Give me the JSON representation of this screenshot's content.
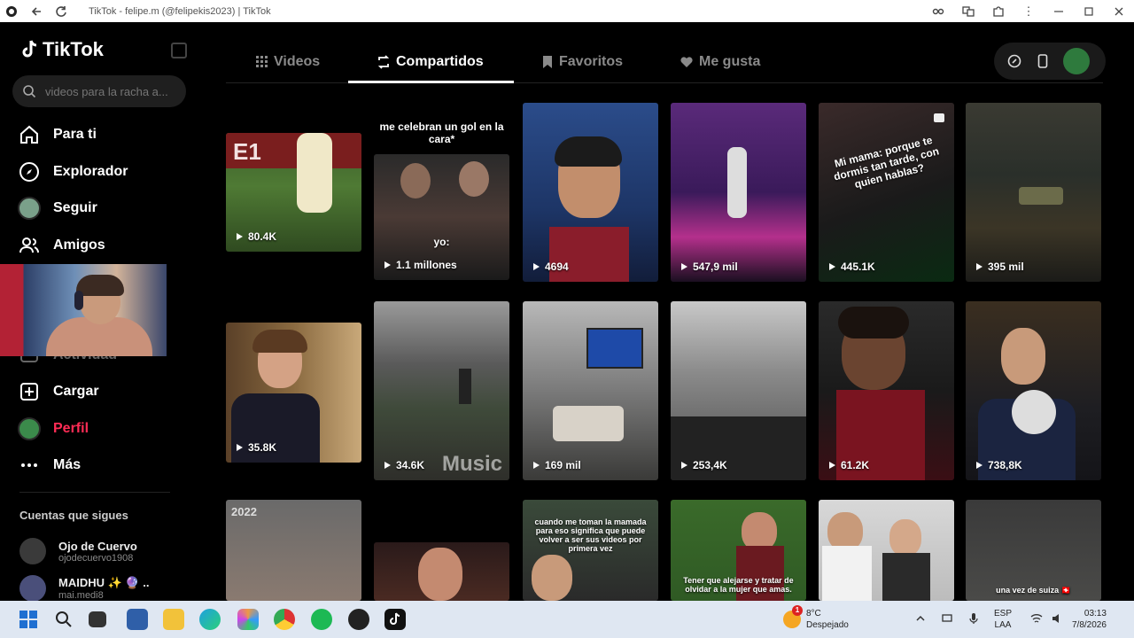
{
  "browser": {
    "title": "TikTok - felipe.m (@felipekis2023) | TikTok"
  },
  "sidebar": {
    "logo_text": "TikTok",
    "search_placeholder": "videos para la racha a...",
    "nav": [
      {
        "label": "Para ti",
        "icon": "home-icon"
      },
      {
        "label": "Explorador",
        "icon": "compass-icon"
      },
      {
        "label": "Seguir",
        "icon": "following-avatar-icon"
      },
      {
        "label": "Amigos",
        "icon": "friends-icon"
      },
      {
        "label": "Actividad",
        "icon": "activity-icon"
      },
      {
        "label": "Cargar",
        "icon": "upload-icon"
      },
      {
        "label": "Perfil",
        "icon": "profile-avatar-icon"
      },
      {
        "label": "Más",
        "icon": "more-icon"
      }
    ],
    "following_title": "Cuentas que sigues",
    "following": [
      {
        "name": "Ojo de Cuervo",
        "username": "ojodecuervo1908"
      },
      {
        "name": "MAIDHU ✨ 🔮 ..",
        "username": "mai.medi8"
      }
    ]
  },
  "tabs": [
    {
      "label": "Videos",
      "icon": "grid-icon"
    },
    {
      "label": "Compartidos",
      "icon": "repost-icon"
    },
    {
      "label": "Favoritos",
      "icon": "bookmark-icon"
    },
    {
      "label": "Me gusta",
      "icon": "heart-icon"
    }
  ],
  "active_tab": "Compartidos",
  "videos": [
    {
      "views": "80.4K",
      "caption": ""
    },
    {
      "views": "1.1 millones",
      "caption": "me celebran un gol en la cara*",
      "overlay": "yo:"
    },
    {
      "views": "4694",
      "caption": ""
    },
    {
      "views": "547,9 mil",
      "caption": ""
    },
    {
      "views": "445.1K",
      "caption": "Mi mama: porque te dormis tan tarde, con quien hablas?"
    },
    {
      "views": "395 mil",
      "caption": ""
    },
    {
      "views": "35.8K",
      "caption": ""
    },
    {
      "views": "34.6K",
      "caption": "",
      "overlay": "Music"
    },
    {
      "views": "169 mil",
      "caption": ""
    },
    {
      "views": "253,4K",
      "caption": ""
    },
    {
      "views": "61.2K",
      "caption": ""
    },
    {
      "views": "738,8K",
      "caption": ""
    },
    {
      "views": "",
      "caption": "",
      "tag": "2022"
    },
    {
      "views": "",
      "caption": ""
    },
    {
      "views": "",
      "caption": "cuando me toman la mamada para eso significa que puede volver a ser sus videos por primera vez"
    },
    {
      "views": "",
      "caption": "Tener que alejarse y tratar de olvidar a la mujer que amas."
    },
    {
      "views": "",
      "caption": ""
    },
    {
      "views": "",
      "caption": "una vez de suiza 🇨🇭"
    }
  ],
  "taskbar": {
    "weather_temp": "8°C",
    "weather_desc": "Despejado",
    "weather_badge": "1",
    "lang_line1": "ESP",
    "lang_line2": "LAA",
    "time": "03:13",
    "date": "7/8/2026"
  }
}
